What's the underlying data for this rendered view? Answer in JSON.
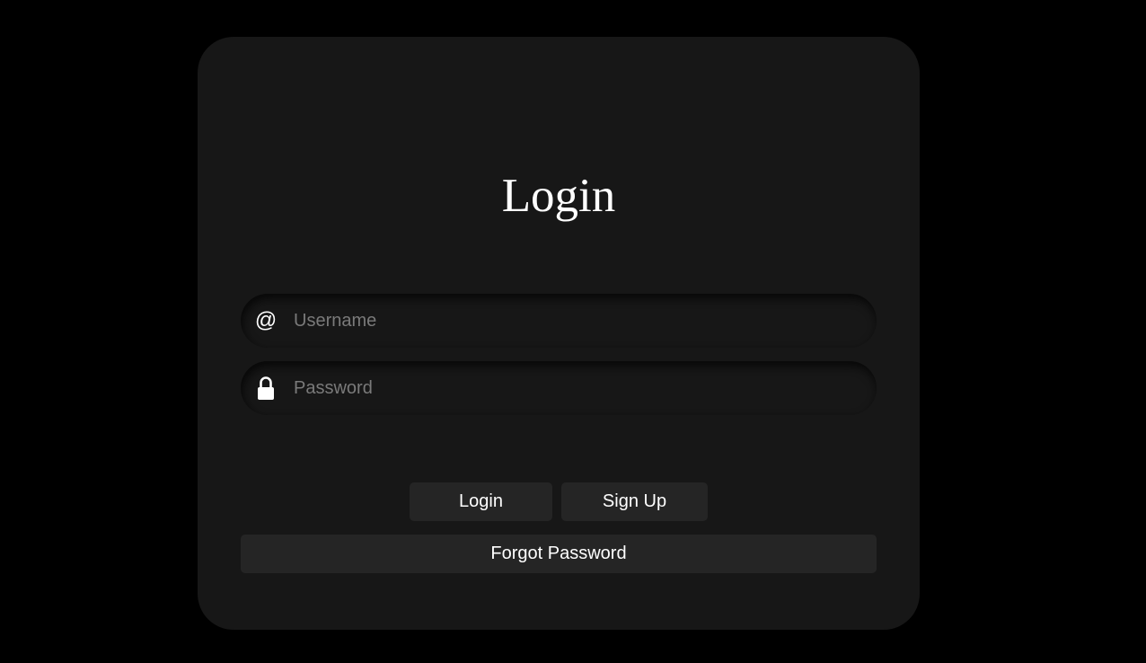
{
  "form": {
    "title": "Login",
    "username": {
      "icon": "at-icon",
      "icon_glyph": "@",
      "placeholder": "Username",
      "value": ""
    },
    "password": {
      "icon": "lock-icon",
      "placeholder": "Password",
      "value": ""
    },
    "buttons": {
      "login_label": "Login",
      "signup_label": "Sign Up",
      "forgot_label": "Forgot Password"
    }
  },
  "colors": {
    "background": "#000000",
    "card": "#171717",
    "button": "#252525",
    "text": "#ffffff",
    "placeholder": "#7a7a7a"
  }
}
